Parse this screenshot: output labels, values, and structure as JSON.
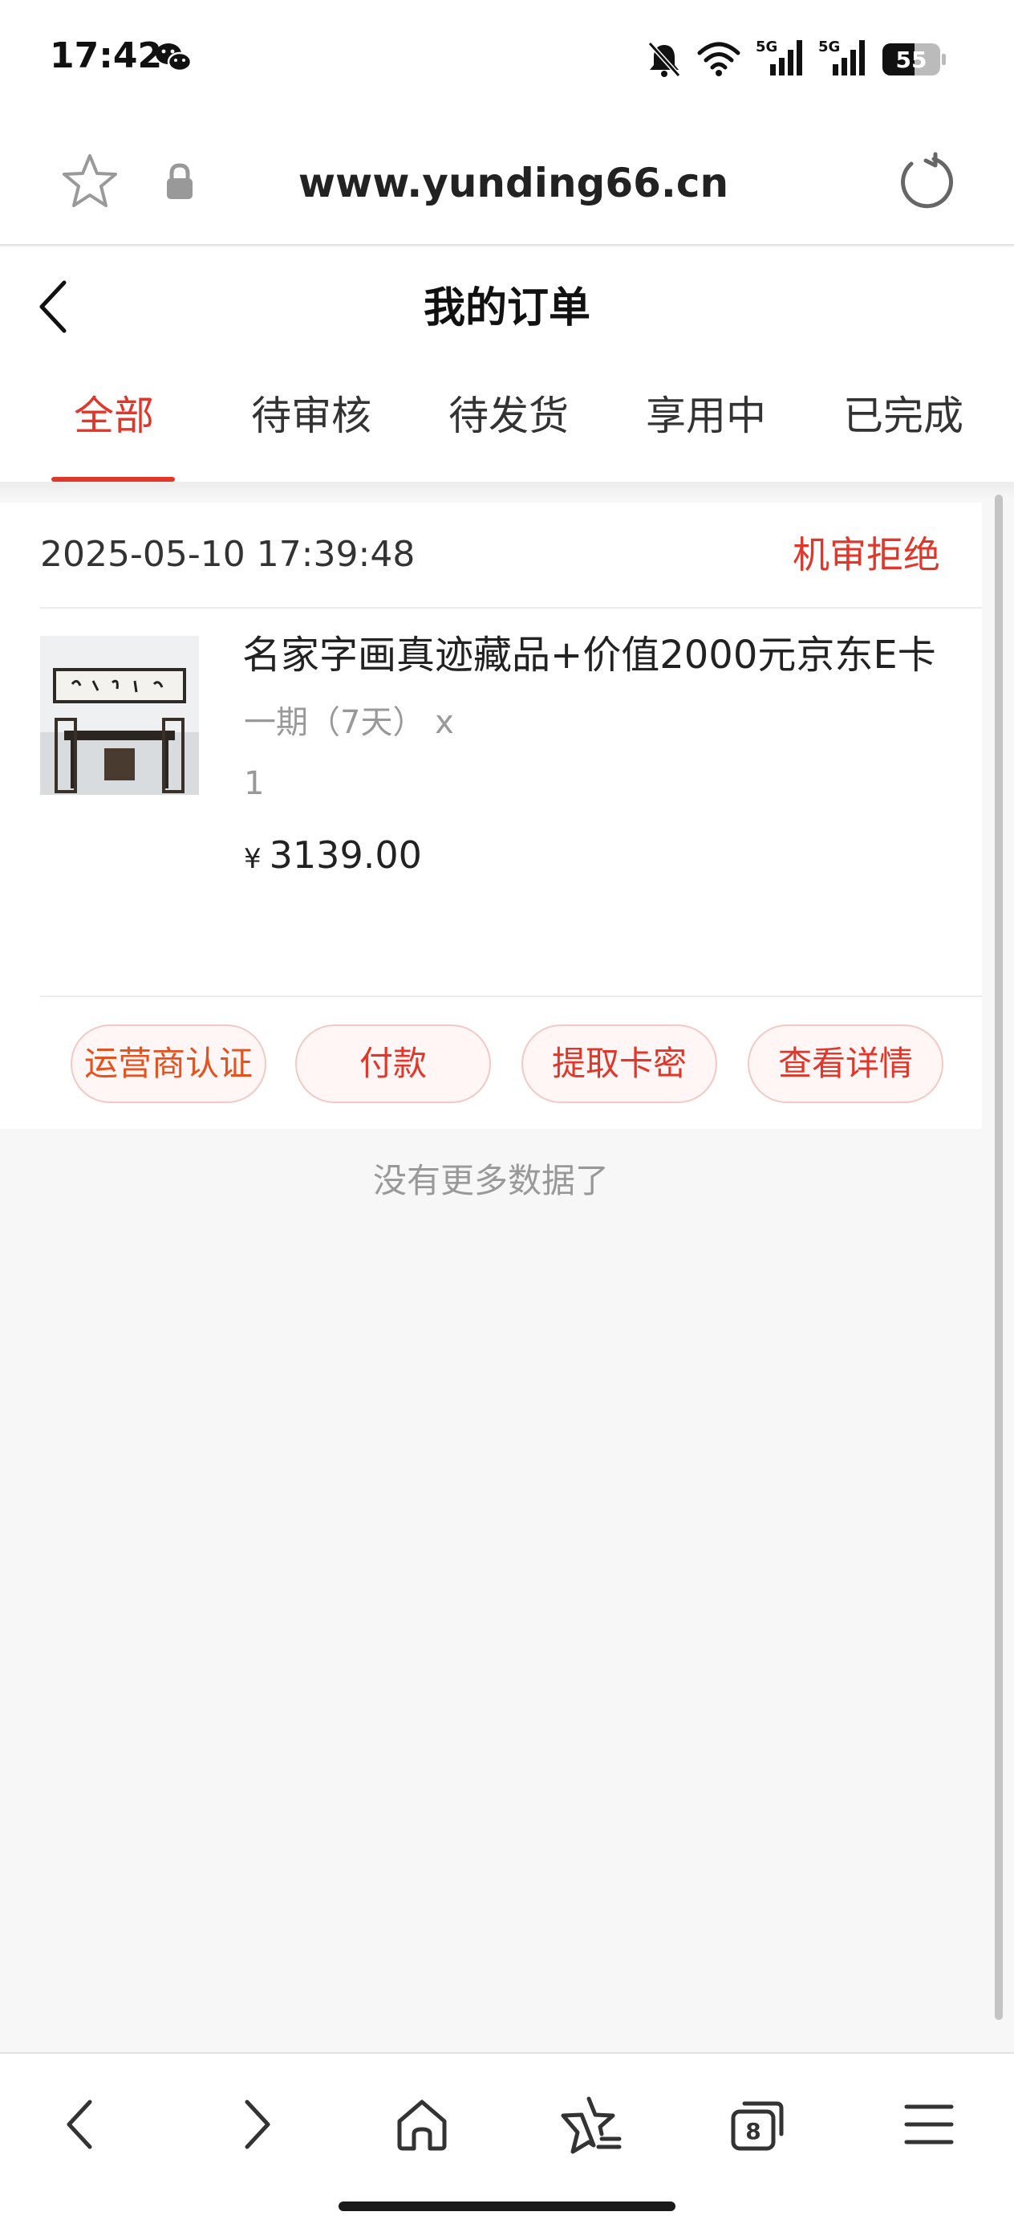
{
  "status_bar": {
    "time": "17:42",
    "battery_level": "55",
    "network_1": "5G",
    "network_2": "5G",
    "icons": [
      "wechat-icon",
      "bell-off-icon",
      "wifi-icon",
      "signal-icon",
      "signal-icon",
      "battery-icon"
    ]
  },
  "browser": {
    "url": "www.yunding66.cn",
    "icons": [
      "star-icon",
      "lock-icon",
      "reload-icon"
    ]
  },
  "header": {
    "title": "我的订单"
  },
  "tabs": [
    {
      "label": "全部",
      "active": true
    },
    {
      "label": "待审核",
      "active": false
    },
    {
      "label": "待发货",
      "active": false
    },
    {
      "label": "享用中",
      "active": false
    },
    {
      "label": "已完成",
      "active": false
    }
  ],
  "order": {
    "time": "2025-05-10 17:39:48",
    "status": "机审拒绝",
    "product_title": "名家字画真迹藏品+价值2000元京东E卡",
    "spec": "一期（7天） x",
    "quantity": "1",
    "currency": "¥",
    "price": "3139.00",
    "actions": {
      "operator_verify": "运营商认证",
      "pay": "付款",
      "extract_card": "提取卡密",
      "view_detail": "查看详情"
    }
  },
  "footer_text": "没有更多数据了",
  "bottom_nav": {
    "tab_count": "8",
    "icons": [
      "back-icon",
      "forward-icon",
      "home-icon",
      "favorites-icon",
      "tabs-icon",
      "menu-icon"
    ]
  },
  "colors": {
    "accent": "#e0372a",
    "operator_button": "#e4531f",
    "background": "#f7f7f7"
  }
}
